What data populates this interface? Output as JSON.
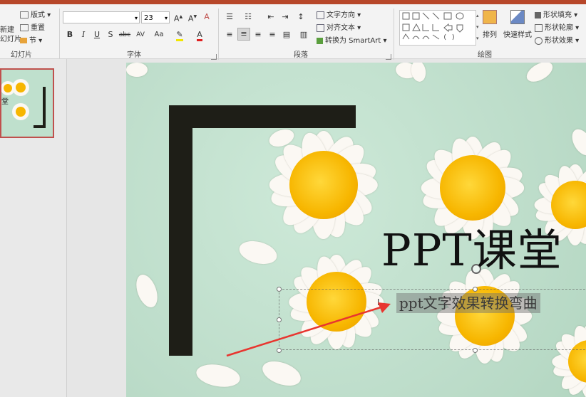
{
  "colors": {
    "accent": "#b7472a",
    "selection": "#c0504d",
    "arrow": "#e8352f",
    "bracket": "#1e1e17",
    "petal": "#fbf8f3",
    "center": "#f7b600"
  },
  "ribbon": {
    "slides_group": {
      "new_slide": "新建\n幻灯片",
      "layout": "版式",
      "reset": "重置",
      "section": "节",
      "label": "幻灯片"
    },
    "font_group": {
      "font_name": "",
      "font_size": "23",
      "bold": "B",
      "italic": "I",
      "underline": "U",
      "shadow": "S",
      "strike": "abc",
      "spacing": "AV",
      "case": "Aa",
      "label": "字体"
    },
    "paragraph_group": {
      "text_direction": "文字方向",
      "align_text": "对齐文本",
      "convert_smartart": "转换为 SmartArt",
      "label": "段落"
    },
    "drawing_group": {
      "arrange": "排列",
      "quick_styles": "快速样式",
      "shape_fill": "形状填充",
      "shape_outline": "形状轮廓",
      "shape_effects": "形状效果",
      "label": "绘图"
    }
  },
  "thumbnail": {
    "text": "堂"
  },
  "slide": {
    "title": "PPT课堂",
    "subtitle": "ppt文字效果转换弯曲"
  }
}
